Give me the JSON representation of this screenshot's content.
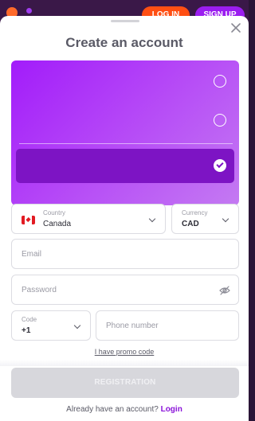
{
  "header": {
    "login_label": "LOG IN",
    "signup_label": "SIGN UP"
  },
  "modal": {
    "title": "Create an account"
  },
  "bonus_options": [
    {
      "selected": false
    },
    {
      "selected": false
    },
    {
      "selected": true
    }
  ],
  "form": {
    "country": {
      "label": "Country",
      "value": "Canada",
      "flag": "canada-flag"
    },
    "currency": {
      "label": "Currency",
      "value": "CAD"
    },
    "email": {
      "placeholder": "Email"
    },
    "password": {
      "placeholder": "Password"
    },
    "code": {
      "label": "Code",
      "value": "+1"
    },
    "phone": {
      "placeholder": "Phone number"
    }
  },
  "promo_link": "I have promo code",
  "register_label": "REGISTRATION",
  "footer": {
    "text": "Already have an account?",
    "link": "Login"
  },
  "colors": {
    "accent": "#8a12d9",
    "card_gradient_start": "#a21cfa",
    "selected_row": "#7d14c4",
    "disabled_button": "#d7d7dc"
  }
}
